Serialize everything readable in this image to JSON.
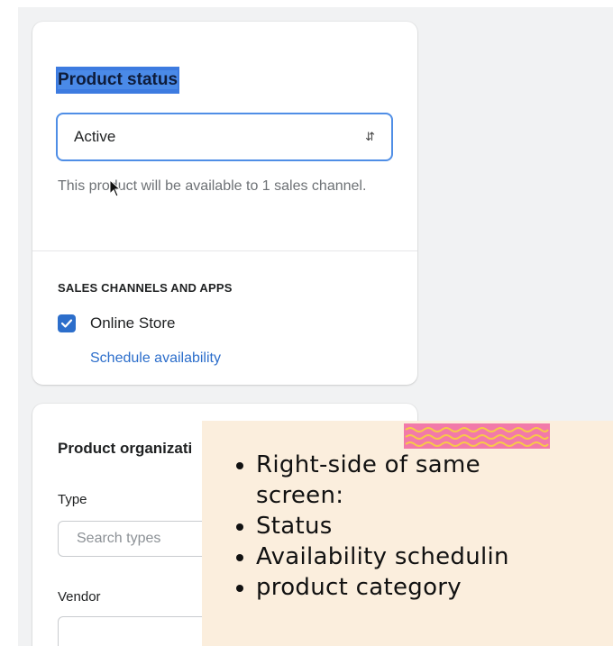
{
  "product_status": {
    "title": "Product status",
    "select_value": "Active",
    "help_text": "This product will be available to 1 sales channel.",
    "channels_heading": "SALES CHANNELS AND APPS",
    "channel_label": "Online Store",
    "channel_checked": true,
    "schedule_link": "Schedule availability"
  },
  "product_organization": {
    "title": "Product organizati",
    "type_label": "Type",
    "type_placeholder": "Search types",
    "vendor_label": "Vendor"
  },
  "note": {
    "bullets": [
      "Right-side of same",
      "screen:",
      "Status",
      "Availability schedulin",
      "product category"
    ]
  },
  "colors": {
    "accent": "#2c6ecb",
    "highlight": "#4a8ae8",
    "note_bg": "#fbeedd",
    "tape": "#f27aa9"
  }
}
